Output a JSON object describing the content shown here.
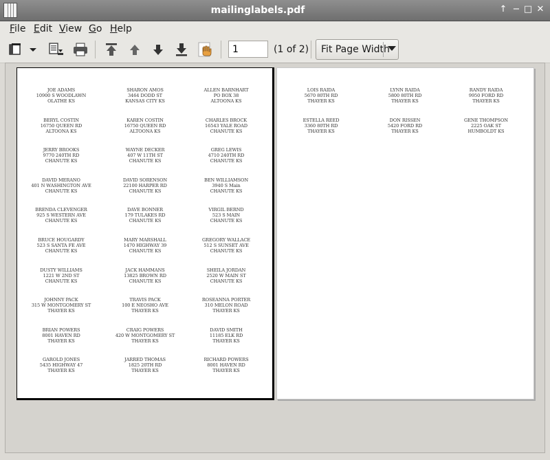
{
  "window": {
    "title": "mailinglabels.pdf",
    "buttons": [
      "↑",
      "−",
      "□",
      "✕"
    ]
  },
  "menu": [
    {
      "key": "F",
      "rest": "ile"
    },
    {
      "key": "E",
      "rest": "dit"
    },
    {
      "key": "V",
      "rest": "iew"
    },
    {
      "key": "G",
      "rest": "o"
    },
    {
      "key": "H",
      "rest": "elp"
    }
  ],
  "toolbar": {
    "page_value": "1",
    "page_count": "(1 of 2)",
    "zoom_label": "Fit Page Width",
    "icons": [
      "sidebar-icon",
      "dropdown-arrow-icon",
      "page-layout-icon",
      "print-icon",
      "first-page-icon",
      "previous-page-icon",
      "next-page-icon",
      "last-page-icon",
      "hand-tool-icon"
    ]
  },
  "pages": [
    {
      "labels": [
        [
          "JOE ADAMS",
          "10900 S WOODLAWN",
          "OLATHE  KS"
        ],
        [
          "SHARON AMOS",
          "3464 DODD ST",
          "KANSAS CITY  KS"
        ],
        [
          "ALLEN BARNHART",
          "PO BOX 38",
          "ALTOONA  KS"
        ],
        [
          "BERYL COSTIN",
          "16750 QUEEN RD",
          "ALTOONA KS"
        ],
        [
          "KAREN COSTIN",
          "16750 QUEEN RD",
          "ALTOONA  KS"
        ],
        [
          "CHARLES BROCK",
          "16543 YALE ROAD",
          "CHANUTE  KS"
        ],
        [
          "JERRY BROOKS",
          "9770 240TH RD",
          "CHANUTE  KS"
        ],
        [
          "WAYNE DECKER",
          "407 W 11TH ST",
          "CHANUTE  KS"
        ],
        [
          "GREG LEWIS",
          "4710 240TH RD",
          "CHANUTE  KS"
        ],
        [
          "DAVID MERANO",
          "401 N WASHINGTON AVE",
          "CHANUTE  KS"
        ],
        [
          "DAVID SORENSON",
          "22100 HARPER RD",
          "CHANUTE  KS"
        ],
        [
          "BEN WILLIAMSON",
          "3940 S Main",
          "CHANUTE  KS"
        ],
        [
          "BRENDA CLEVENGER",
          "925 S WESTERN AVE",
          "CHANUTE  KS"
        ],
        [
          "DAVE BONNER",
          "179 TULAKES RD",
          "CHANUTE  KS"
        ],
        [
          "VIRGIL BERND",
          "523 S MAIN",
          "CHANUTE  KS"
        ],
        [
          "BRUCE HOUGARDY",
          "523 S SANTA FE AVE",
          "CHANUTE  KS"
        ],
        [
          "MARY MARSHALL",
          "1470 HIGHWAY 39",
          "CHANUTE  KS"
        ],
        [
          "GREGORY WALLACE",
          "512 S SUNSET AVE",
          "CHANUTE  KS"
        ],
        [
          "DUSTY WILLIAMS",
          "1221 W 2ND ST",
          "CHANUTE  KS"
        ],
        [
          "JACK HAMMANS",
          "13825 BROWN RD",
          "CHANUTE  KS"
        ],
        [
          "SHEILA JORDAN",
          "2520 W MAIN ST",
          "CHANUTE  KS"
        ],
        [
          "JOHNNY PACK",
          "315 W MONTGOMERY ST",
          "THAYER  KS"
        ],
        [
          "TRAVIS PACK",
          "100 E NEOSHO AVE",
          "THAYER  KS"
        ],
        [
          "ROSEANNA PORTER",
          "310 MELON ROAD",
          "THAYER  KS"
        ],
        [
          "BRIAN POWERS",
          "8001 HAVEN RD",
          "THAYER  KS"
        ],
        [
          "CRAIG POWERS",
          "420 W MONTGOMERY ST",
          "THAYER  KS"
        ],
        [
          "DAVID SMITH",
          "11185 ELK RD",
          "THAYER  KS"
        ],
        [
          "GAROLD JONES",
          "5435 HIGHWAY 47",
          "THAYER  KS"
        ],
        [
          "JARRED THOMAS",
          "1825 20TH RD",
          "THAYER  KS"
        ],
        [
          "RICHARD POWERS",
          "8001 HAVEN RD",
          "THAYER  KS"
        ]
      ]
    },
    {
      "labels": [
        [
          "LOIS RAIDA",
          "5670 80TH RD",
          "THAYER  KS"
        ],
        [
          "LYNN RAIDA",
          "5800 80TH RD",
          "THAYER  KS"
        ],
        [
          "RANDY RAIDA",
          "9950 FORD RD",
          "THAYER  KS"
        ],
        [
          "ESTELLA REED",
          "3360 80TH RD",
          "THAYER  KS"
        ],
        [
          "DON RISSEN",
          "5420 FORD RD",
          "THAYER  KS"
        ],
        [
          "GENE THOMPSON",
          "2225 OAK ST",
          "HUMBOLDT  KS"
        ]
      ]
    }
  ]
}
